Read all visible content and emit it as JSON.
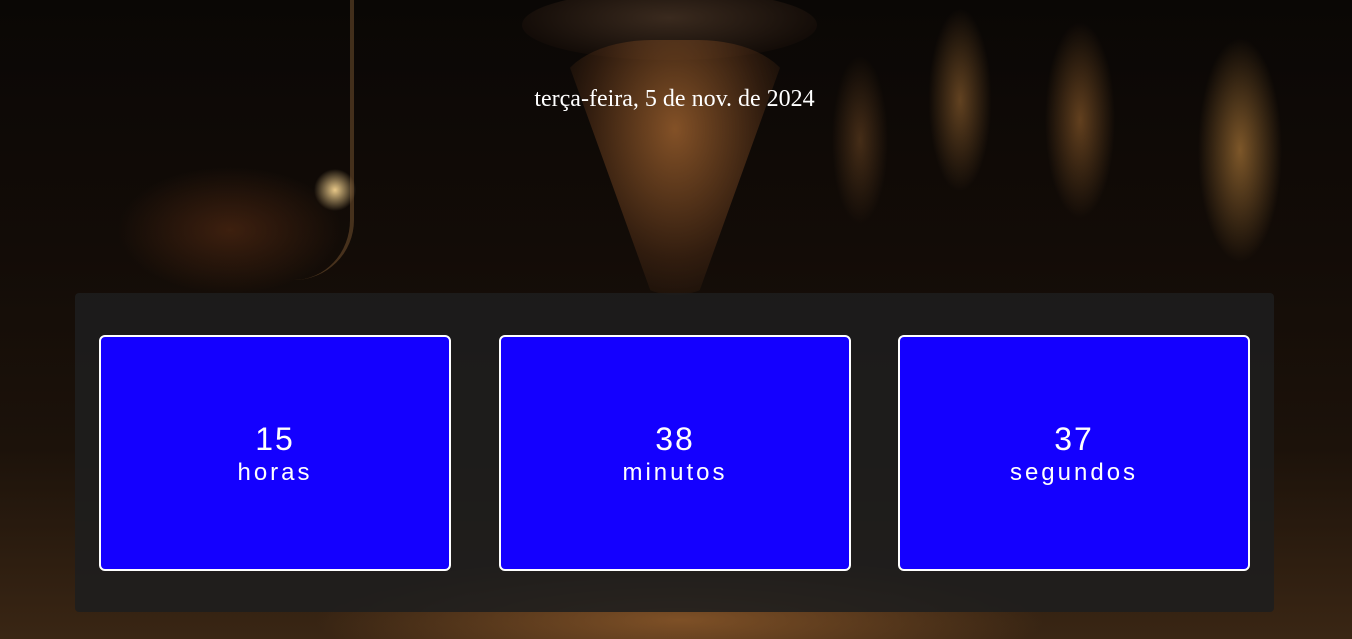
{
  "date": "terça-feira, 5 de nov. de 2024",
  "countdown": [
    {
      "value": "15",
      "unit": "horas"
    },
    {
      "value": "38",
      "unit": "minutos"
    },
    {
      "value": "37",
      "unit": "segundos"
    }
  ],
  "colors": {
    "card_background": "#1400ff",
    "card_border": "#ffffff",
    "panel_background": "#1e1e1e",
    "text": "#ffffff"
  }
}
